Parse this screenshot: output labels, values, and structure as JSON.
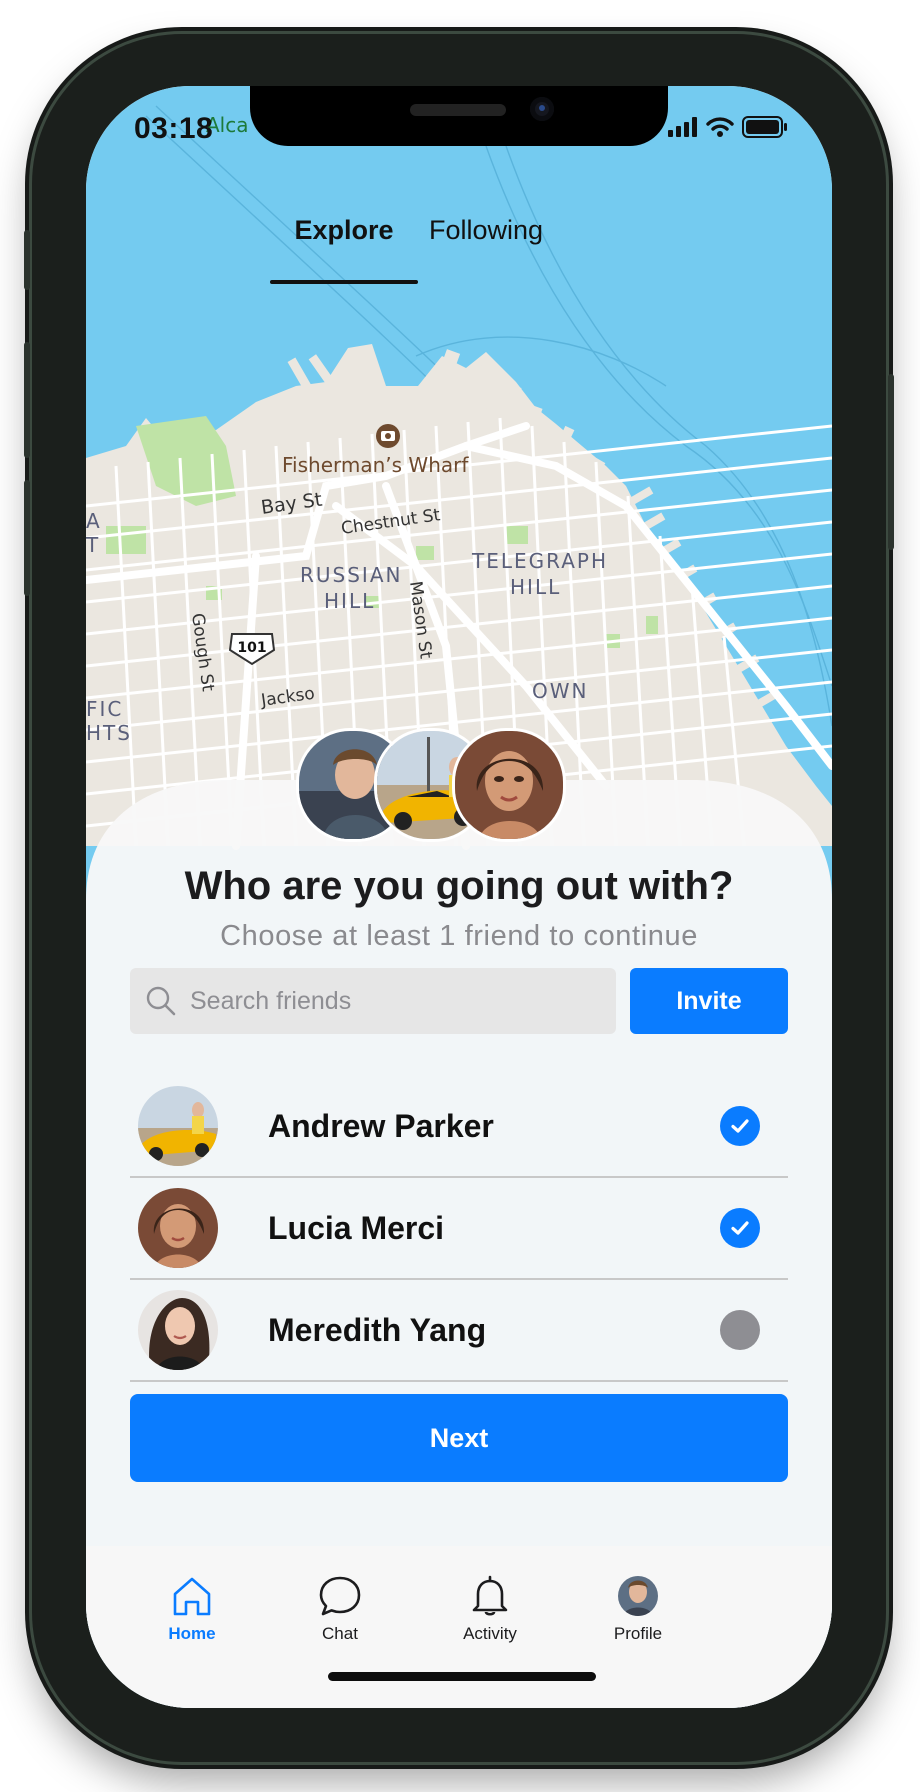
{
  "status_bar": {
    "time": "03:18"
  },
  "tabs": [
    {
      "label": "Explore",
      "active": true
    },
    {
      "label": "Following",
      "active": false
    }
  ],
  "map": {
    "labels": {
      "fishermans_wharf": "Fisherman’s Wharf",
      "bay_st": "Bay St",
      "chestnut_st": "Chestnut St",
      "russian": "RUSSIAN",
      "hill1": "HILL",
      "telegraph": "TELEGRAPH",
      "hill2": "HILL",
      "mason_st": "Mason St",
      "gough_st": "Gough St",
      "route": "101",
      "jackson": "Jackso",
      "partial_a": "A",
      "partial_t": "T",
      "partial_fic": "FIC",
      "partial_hts": "HTS",
      "alca": "Alca",
      "town": "OWN"
    },
    "colors": {
      "water": "#74cbf0",
      "land": "#ebe7e0",
      "park": "#bfe3a6",
      "street": "#ffffff"
    }
  },
  "sheet": {
    "title": "Who are you going out with?",
    "subtitle": "Choose at least 1 friend to continue",
    "search": {
      "placeholder": "Search friends",
      "value": ""
    },
    "invite_label": "Invite",
    "friends": [
      {
        "name": "Andrew Parker",
        "selected": true
      },
      {
        "name": "Lucia Merci",
        "selected": true
      },
      {
        "name": "Meredith Yang",
        "selected": false
      }
    ],
    "next_label": "Next"
  },
  "tabbar": [
    {
      "label": "Home",
      "icon": "home-icon",
      "active": true
    },
    {
      "label": "Chat",
      "icon": "chat-bubble-icon",
      "active": false
    },
    {
      "label": "Activity",
      "icon": "bell-icon",
      "active": false
    },
    {
      "label": "Profile",
      "icon": "profile-avatar",
      "active": false
    }
  ],
  "accent_color": "#0a7cff"
}
